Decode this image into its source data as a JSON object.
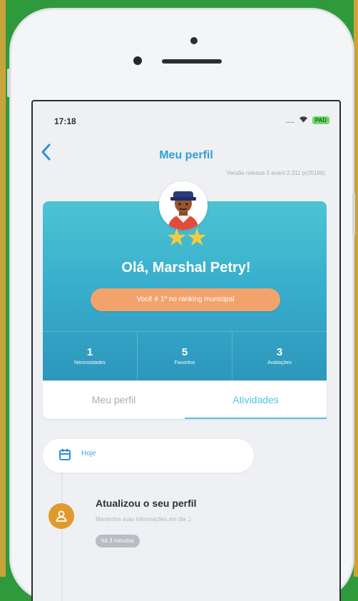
{
  "status_bar": {
    "time": "17:18",
    "network": "....",
    "battery": "PAD"
  },
  "nav": {
    "title": "Meu perfil",
    "version": "Versão release 3 avant 2.311 pr(f0186)"
  },
  "profile": {
    "stars": "★★",
    "greeting": "Olá, Marshal Petry!",
    "ranking_text": "Você é 1º no ranking municipal"
  },
  "stats": [
    {
      "value": "1",
      "label": "Necessidades"
    },
    {
      "value": "5",
      "label": "Favoritos"
    },
    {
      "value": "3",
      "label": "Avaliações"
    }
  ],
  "tabs": [
    {
      "label": "Meu perfil",
      "active": false
    },
    {
      "label": "Atividades",
      "active": true
    }
  ],
  "timeline": {
    "section_label": "Hoje",
    "activity": {
      "title": "Atualizou o seu perfil",
      "description": "Mantenha suas informações em dia :)",
      "time": "há 3 minutos"
    }
  },
  "colors": {
    "card_gradient_top": "#4dc3d3",
    "card_gradient_bottom": "#2d96bc",
    "accent_blue": "#54c2e2",
    "star_yellow": "#f5cb3d",
    "ranking_pill": "#f2a36c",
    "activity_icon": "#e09a2c",
    "outer_background": "#2e9a3c"
  },
  "icons": [
    "back-chevron-icon",
    "wifi-icon",
    "battery-icon",
    "calendar-icon",
    "user-icon"
  ]
}
